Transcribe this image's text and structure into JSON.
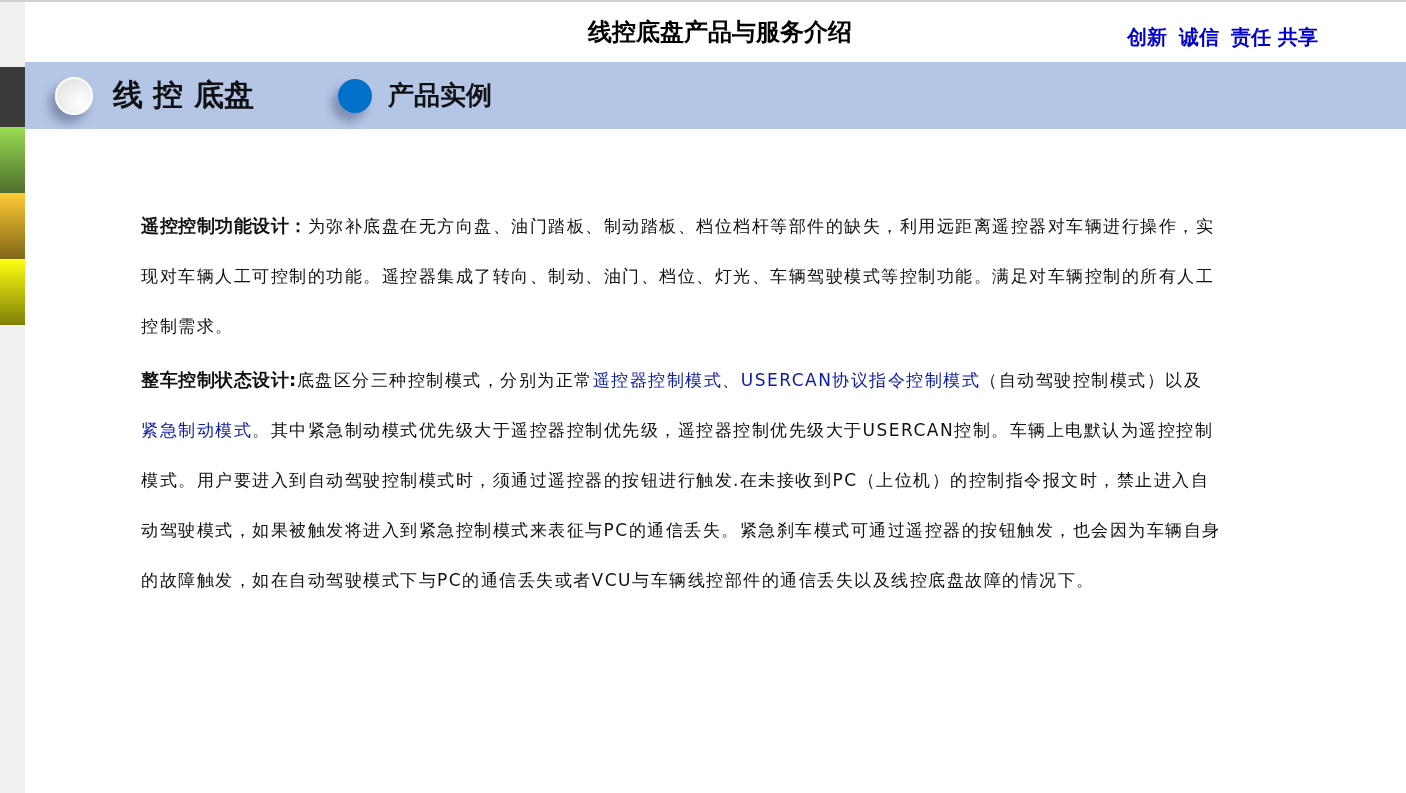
{
  "header": {
    "title": "线控底盘产品与服务介绍",
    "links": [
      "创新",
      "诚信",
      "责任 共享"
    ]
  },
  "side_tabs": [
    {
      "color": "#3a3a3a"
    },
    {
      "color": "#9add55"
    },
    {
      "color": "#ffcc33"
    },
    {
      "color": "#ffff10"
    }
  ],
  "band": {
    "section_title": "线 控 底盘",
    "tabs": [
      {
        "label": "产品实例",
        "selected": true
      }
    ]
  },
  "paragraphs": [
    {
      "lead": "遥控控制功能设计：",
      "segments": [
        {
          "kind": "text",
          "text": "为弥补底盘在无方向盘、油门踏板、制动踏板、档位档杆等部件的缺失，利用远距离遥控器对车辆进行操作，实现对车辆人工可控制的功能。遥控器集成了转向、制动、油门、档位、灯光、车辆驾驶模式等控制功能。满足对车辆控制的所有人工控制需求。"
        }
      ]
    },
    {
      "lead": "整车控制状态设计:",
      "segments": [
        {
          "kind": "text",
          "text": "底盘区分三种控制模式，分别为正常"
        },
        {
          "kind": "link",
          "text": "遥控器控制模式、USERCAN协议指令控制模式"
        },
        {
          "kind": "text",
          "text": "（自动驾驶控制模式）以及"
        },
        {
          "kind": "link",
          "text": "紧急制动模式"
        },
        {
          "kind": "text",
          "text": "。其中紧急制动模式优先级大于遥控器控制优先级，遥控器控制优先级大于USERCAN控制。车辆上电默认为遥控控制模式。用户要进入到自动驾驶控制模式时，须通过遥控器的按钮进行触发.在未接收到PC（上位机）的控制指令报文时，禁止进入自动驾驶模式，如果被触发将进入到紧急控制模式来表征与PC的通信丢失。紧急刹车模式可通过遥控器的按钮触发，也会因为车辆自身的故障触发，如在自动驾驶模式下与PC的通信丢失或者VCU与车辆线控部件的通信丢失以及线控底盘故障的情况下。"
        }
      ]
    }
  ]
}
